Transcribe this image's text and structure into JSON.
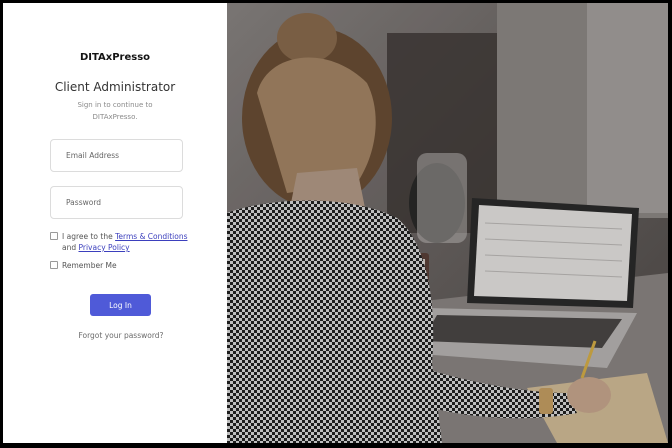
{
  "brand": "DITAxPresso",
  "heading": "Client Administrator",
  "subheading": "Sign in to continue to DITAxPresso.",
  "form": {
    "email_placeholder": "Email Address",
    "password_placeholder": "Password",
    "terms": {
      "prefix": "I agree to the ",
      "terms_link": "Terms & Conditions",
      "middle": "and ",
      "privacy_link": "Privacy Policy",
      "checked": false
    },
    "remember": {
      "label": "Remember Me",
      "checked": false
    },
    "login_label": "Log In",
    "forgot_label": "Forgot your password?"
  },
  "colors": {
    "accent": "#4f5ad8",
    "link": "#3b3fbd"
  },
  "photo": {
    "description_icon": "woman-working-at-laptop-photo"
  }
}
